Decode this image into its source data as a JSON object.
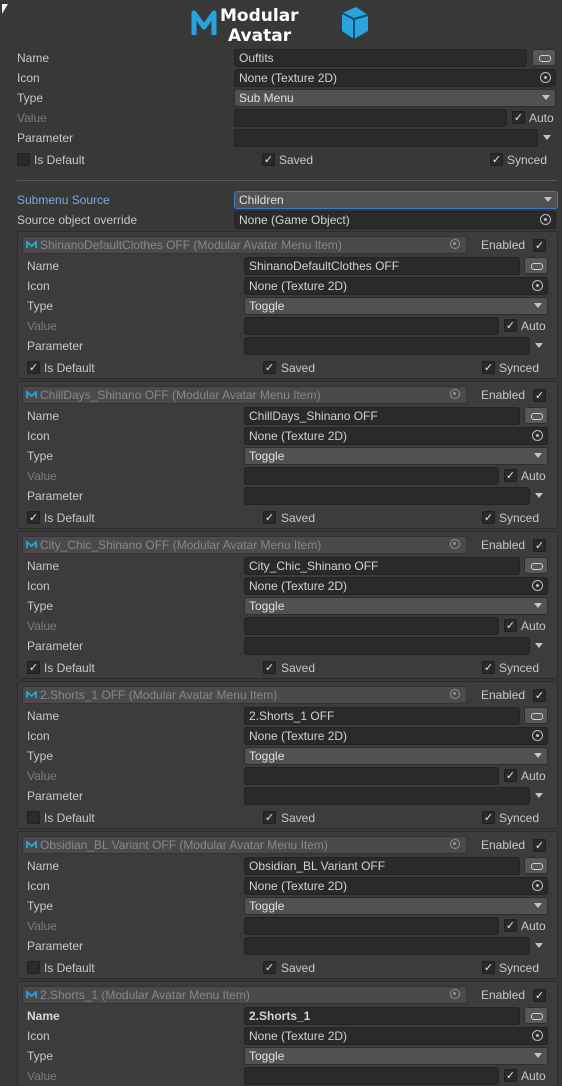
{
  "logo": {
    "line1": "Modular",
    "line2": "Avatar"
  },
  "menu": {
    "name_label": "Name",
    "name_value": "Ouftits",
    "icon_label": "Icon",
    "icon_value": "None (Texture 2D)",
    "type_label": "Type",
    "type_value": "Sub Menu",
    "value_label": "Value",
    "auto_label": "Auto",
    "auto_checked": true,
    "parameter_label": "Parameter",
    "isdefault_label": "Is Default",
    "isdefault_checked": false,
    "saved_label": "Saved",
    "saved_checked": true,
    "synced_label": "Synced",
    "synced_checked": true,
    "submenu_source_label": "Submenu Source",
    "submenu_source_value": "Children",
    "source_override_label": "Source object override",
    "source_override_value": "None (Game Object)"
  },
  "children": [
    {
      "header": "ShinanoDefaultClothes OFF (Modular Avatar Menu Item)",
      "enabled_label": "Enabled",
      "enabled": true,
      "name_label": "Name",
      "name_value": "ShinanoDefaultClothes OFF",
      "icon_label": "Icon",
      "icon_value": "None (Texture 2D)",
      "type_label": "Type",
      "type_value": "Toggle",
      "value_label": "Value",
      "auto_label": "Auto",
      "auto": true,
      "parameter_label": "Parameter",
      "isdefault_label": "Is Default",
      "isdefault": true,
      "saved_label": "Saved",
      "saved": true,
      "synced_label": "Synced",
      "synced": true
    },
    {
      "header": "ChillDays_Shinano OFF (Modular Avatar Menu Item)",
      "enabled_label": "Enabled",
      "enabled": true,
      "name_label": "Name",
      "name_value": "ChillDays_Shinano OFF",
      "icon_label": "Icon",
      "icon_value": "None (Texture 2D)",
      "type_label": "Type",
      "type_value": "Toggle",
      "value_label": "Value",
      "auto_label": "Auto",
      "auto": true,
      "parameter_label": "Parameter",
      "isdefault_label": "Is Default",
      "isdefault": true,
      "saved_label": "Saved",
      "saved": true,
      "synced_label": "Synced",
      "synced": true
    },
    {
      "header": "City_Chic_Shinano OFF (Modular Avatar Menu Item)",
      "enabled_label": "Enabled",
      "enabled": true,
      "name_label": "Name",
      "name_value": "City_Chic_Shinano OFF",
      "icon_label": "Icon",
      "icon_value": "None (Texture 2D)",
      "type_label": "Type",
      "type_value": "Toggle",
      "value_label": "Value",
      "auto_label": "Auto",
      "auto": true,
      "parameter_label": "Parameter",
      "isdefault_label": "Is Default",
      "isdefault": true,
      "saved_label": "Saved",
      "saved": true,
      "synced_label": "Synced",
      "synced": true
    },
    {
      "header": "2.Shorts_1 OFF (Modular Avatar Menu Item)",
      "enabled_label": "Enabled",
      "enabled": true,
      "name_label": "Name",
      "name_value": "2.Shorts_1 OFF",
      "icon_label": "Icon",
      "icon_value": "None (Texture 2D)",
      "type_label": "Type",
      "type_value": "Toggle",
      "value_label": "Value",
      "auto_label": "Auto",
      "auto": true,
      "parameter_label": "Parameter",
      "isdefault_label": "Is Default",
      "isdefault": false,
      "saved_label": "Saved",
      "saved": true,
      "synced_label": "Synced",
      "synced": true
    },
    {
      "header": "Obsidian_BL Variant OFF (Modular Avatar Menu Item)",
      "enabled_label": "Enabled",
      "enabled": true,
      "name_label": "Name",
      "name_value": "Obsidian_BL Variant OFF",
      "icon_label": "Icon",
      "icon_value": "None (Texture 2D)",
      "type_label": "Type",
      "type_value": "Toggle",
      "value_label": "Value",
      "auto_label": "Auto",
      "auto": true,
      "parameter_label": "Parameter",
      "isdefault_label": "Is Default",
      "isdefault": false,
      "saved_label": "Saved",
      "saved": true,
      "synced_label": "Synced",
      "synced": true
    },
    {
      "header": "2.Shorts_1 (Modular Avatar Menu Item)",
      "enabled_label": "Enabled",
      "enabled": true,
      "name_label": "Name",
      "name_value": "2.Shorts_1",
      "bold": true,
      "icon_label": "Icon",
      "icon_value": "None (Texture 2D)",
      "type_label": "Type",
      "type_value": "Toggle",
      "value_label": "Value",
      "auto_label": "Auto",
      "auto": true
    }
  ],
  "colors": {
    "background": "#383838",
    "field": "#2a2a2a",
    "highlight": "#3c78c8",
    "logo_blue": "#27a4dd"
  }
}
